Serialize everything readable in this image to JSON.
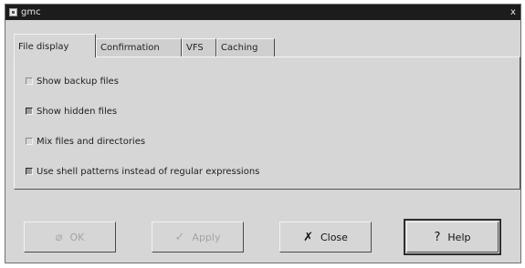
{
  "window": {
    "title": "gmc",
    "close_glyph": "x"
  },
  "tabs": [
    {
      "label": "File display",
      "active": true
    },
    {
      "label": "Confirmation",
      "active": false
    },
    {
      "label": "VFS",
      "active": false
    },
    {
      "label": "Caching",
      "active": false
    }
  ],
  "options": [
    {
      "label": "Show backup files",
      "checked": false
    },
    {
      "label": "Show hidden files",
      "checked": true
    },
    {
      "label": "Mix files and directories",
      "checked": false
    },
    {
      "label": "Use shell patterns instead of regular expressions",
      "checked": true
    }
  ],
  "buttons": {
    "ok": {
      "label": "OK",
      "icon": "ok-icon",
      "glyph": "⌀",
      "enabled": false
    },
    "apply": {
      "label": "Apply",
      "icon": "apply-icon",
      "glyph": "✓",
      "enabled": false
    },
    "close": {
      "label": "Close",
      "icon": "close-icon",
      "glyph": "✗",
      "enabled": true
    },
    "help": {
      "label": "Help",
      "icon": "help-icon",
      "glyph": "?",
      "enabled": true
    }
  }
}
